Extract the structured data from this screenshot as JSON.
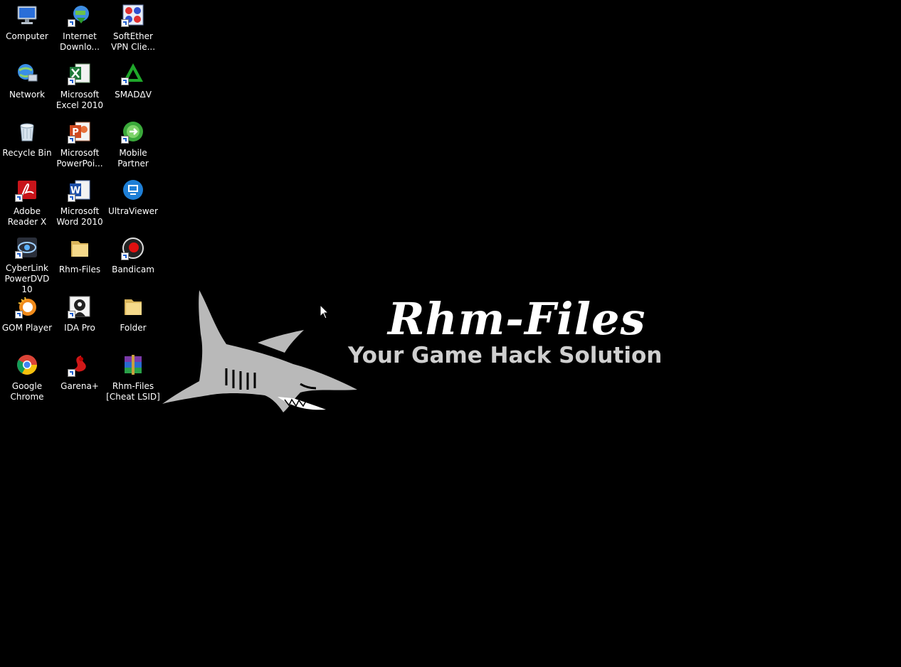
{
  "desktop": {
    "icons": [
      {
        "label": "Computer",
        "icon": "computer-icon"
      },
      {
        "label": "Internet\nDownlo...",
        "icon": "internet-download-manager-icon"
      },
      {
        "label": "SoftEther\nVPN Clie...",
        "icon": "softether-vpn-icon"
      },
      {
        "label": "Network",
        "icon": "network-icon"
      },
      {
        "label": "Microsoft\nExcel 2010",
        "icon": "excel-icon"
      },
      {
        "label": "SMADΔV",
        "icon": "smadav-icon"
      },
      {
        "label": "Recycle Bin",
        "icon": "recycle-bin-icon"
      },
      {
        "label": "Microsoft\nPowerPoi...",
        "icon": "powerpoint-icon"
      },
      {
        "label": "Mobile\nPartner",
        "icon": "mobile-partner-icon"
      },
      {
        "label": "Adobe\nReader X",
        "icon": "adobe-reader-icon"
      },
      {
        "label": "Microsoft\nWord 2010",
        "icon": "word-icon"
      },
      {
        "label": "UltraViewer",
        "icon": "ultraviewer-icon"
      },
      {
        "label": "CyberLink\nPowerDVD 10",
        "icon": "powerdvd-icon"
      },
      {
        "label": "Rhm-Files",
        "icon": "folder-icon"
      },
      {
        "label": "Bandicam",
        "icon": "bandicam-icon"
      },
      {
        "label": "GOM Player",
        "icon": "gom-player-icon"
      },
      {
        "label": "IDA Pro",
        "icon": "ida-pro-icon"
      },
      {
        "label": "Folder",
        "icon": "folder-icon"
      },
      {
        "label": "Google\nChrome",
        "icon": "chrome-icon"
      },
      {
        "label": "Garena+",
        "icon": "garena-icon"
      },
      {
        "label": "Rhm-Files\n[Cheat LSID]",
        "icon": "winrar-archive-icon"
      }
    ]
  },
  "wallpaper": {
    "title": "Rhm-Files",
    "subtitle": "Your Game Hack Solution"
  }
}
